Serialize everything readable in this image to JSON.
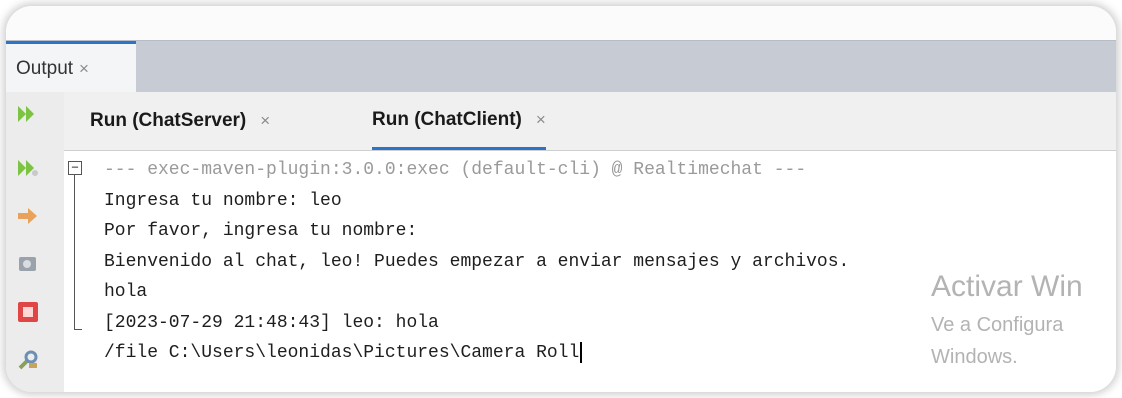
{
  "output_tab": {
    "label": "Output",
    "close": "×"
  },
  "run_tabs": [
    {
      "label": "Run (ChatServer)",
      "close": "×",
      "active": false
    },
    {
      "label": "Run (ChatClient)",
      "close": "×",
      "active": true
    }
  ],
  "gutter_icons": [
    "rerun-icon",
    "rerun-with-options-icon",
    "step-icon",
    "settings-icon",
    "stop-icon",
    "tools-icon"
  ],
  "console": {
    "fold_symbol": "−",
    "lines": [
      "--- exec-maven-plugin:3.0.0:exec (default-cli) @ Realtimechat ---",
      "Ingresa tu nombre: leo",
      "Por favor, ingresa tu nombre:",
      "Bienvenido al chat, leo! Puedes empezar a enviar mensajes y archivos.",
      "hola",
      "[2023-07-29 21:48:43] leo: hola",
      "/file C:\\Users\\leonidas\\Pictures\\Camera Roll"
    ]
  },
  "watermark": {
    "title": "Activar Win",
    "line2": "Ve a Configura",
    "line3": "Windows."
  },
  "colors": {
    "accent": "#2b74c8",
    "tabbar": "#c7ccd4",
    "run_green": "#7cc243",
    "stop_red": "#e04646"
  }
}
